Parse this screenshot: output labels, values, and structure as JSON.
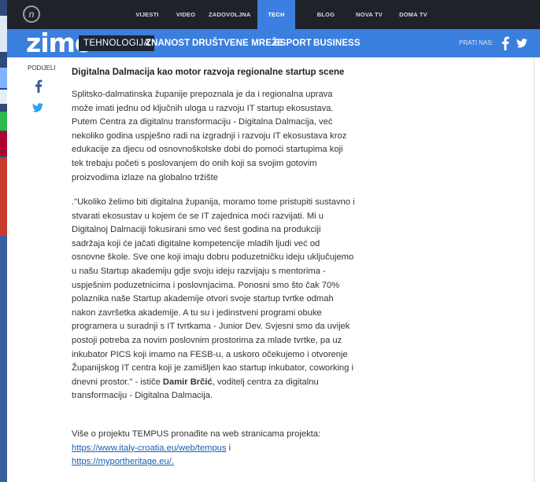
{
  "topnav": {
    "logo_char": "n",
    "items": [
      {
        "label": "VIJESTI"
      },
      {
        "label": "VIDEO"
      },
      {
        "label": "ZADOVOLJNA"
      },
      {
        "label": "TECH",
        "active": true
      },
      {
        "label": "BLOG"
      },
      {
        "label": "NOVA TV"
      },
      {
        "label": "DOMA TV"
      }
    ]
  },
  "secnav": {
    "brand": "zimo",
    "items": [
      {
        "label": "TEHNOLOGIJA",
        "active": true
      },
      {
        "label": "ZNANOST"
      },
      {
        "label": "DRUŠTVENE MREŽE"
      },
      {
        "label": "ESPORT"
      },
      {
        "label": "BUSINESS"
      }
    ],
    "follow_label": "PRATI NAS:"
  },
  "share": {
    "label": "PODIJELI"
  },
  "article": {
    "heading": "Digitalna Dalmacija kao motor razvoja regionalne startup scene",
    "paragraph1": "Splitsko-dalmatinska županije prepoznala je da i regionalna uprava može imati jednu od ključnih uloga u razvoju IT startup ekosustava. Putem Centra za digitalnu transformaciju - Digitalna Dalmacija, već nekoliko godina uspješno radi na izgradnji i razvoju IT ekosustava kroz edukacije za djecu od osnovnoškolske dobi do pomoći startupima koji tek trebaju početi s poslovanjem do onih koji sa svojim gotovim proizvodima izlaze na globalno tržište",
    "paragraph2_before": ".\"Ukoliko želimo biti digitalna županija, moramo tome pristupiti sustavno i stvarati ekosustav u kojem će se IT zajednica moći razvijati. Mi u Digitalnoj Dalmaciji fokusirani smo već šest godina na produkciji sadržaja koji će jačati digitalne kompetencije mladih ljudi već od osnovne škole. Sve one koji imaju dobru poduzetničku ideju uključujemo u našu Startup akademiju gdje svoju ideju razvijaju s mentorima - uspješnim poduzetnicima i poslovnjacima. Ponosni smo što čak 70% polaznika naše Startup akademije otvori svoje startup tvrtke odmah nakon završetka akademije. A tu su i jedinstveni programi obuke programera u suradnji s IT tvrtkama - Junior Dev. Svjesni smo da uvijek postoji potreba za novim poslovnim prostorima za mlade tvrtke, pa uz inkubator PICS koji imamo na FESB-u, a uskoro očekujemo i otvorenje Županijskog IT centra koji je zamišljen kao startup inkubator, coworking i dnevni prostor.\" - ističe ",
    "paragraph2_bold": "Damir Brčić",
    "paragraph2_after": ", voditelj centra za digitalnu transformaciju - Digitalna Dalmacija.",
    "paragraph3_before": "Više o projektu TEMPUS pronađite na web stranicama projekta: ",
    "link1": "https://www.italy-croatia.eu/web/tempus",
    "paragraph3_mid": " i ",
    "link2": "https://myportheritage.eu/."
  }
}
